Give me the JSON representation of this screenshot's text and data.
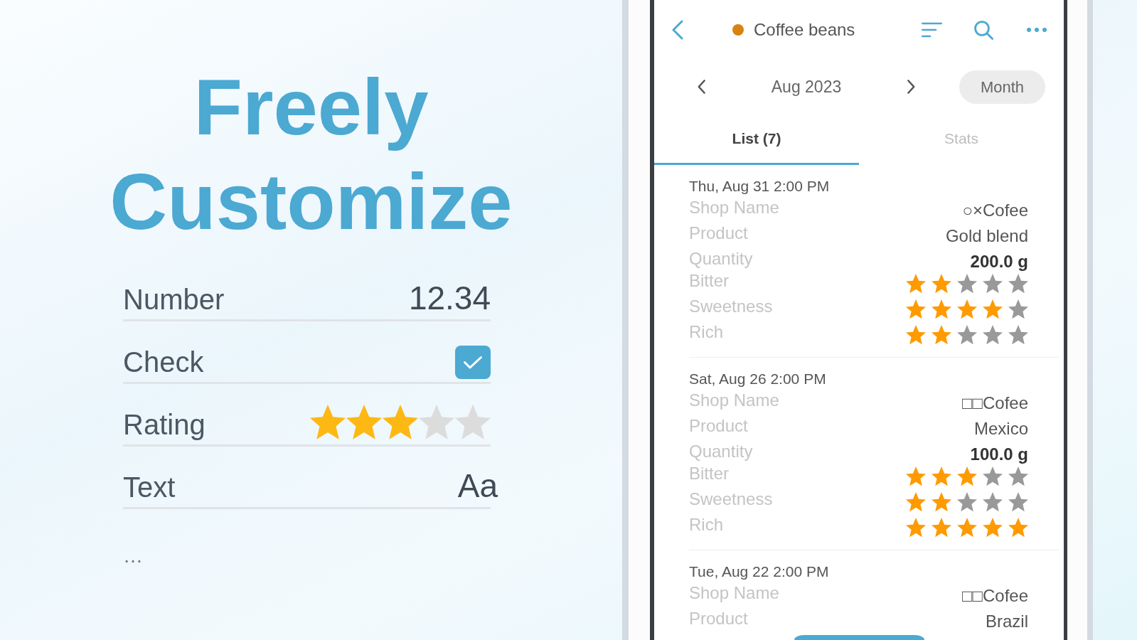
{
  "headline": [
    "Freely",
    "Customize"
  ],
  "field_types": [
    {
      "kind": "number",
      "label": "Number",
      "value": "12.34"
    },
    {
      "kind": "check",
      "label": "Check",
      "checked": true
    },
    {
      "kind": "rating",
      "label": "Rating",
      "stars": 3
    },
    {
      "kind": "text",
      "label": "Text",
      "value": "Aa"
    }
  ],
  "more": "…",
  "phone": {
    "title": "Coffee beans",
    "period": "Aug 2023",
    "period_mode": "Month",
    "tabs": [
      {
        "label": "List (7)",
        "selected": true
      },
      {
        "label": "Stats",
        "selected": false
      }
    ],
    "entries": [
      {
        "date": "Thu, Aug 31 2:00 PM",
        "fields": [
          {
            "kind": "text",
            "label": "Shop Name",
            "value": "○×Cofee"
          },
          {
            "kind": "text",
            "label": "Product",
            "value": "Gold blend"
          },
          {
            "kind": "number",
            "label": "Quantity",
            "value": "200.0 g"
          },
          {
            "kind": "rating",
            "label": "Bitter",
            "stars": 2
          },
          {
            "kind": "rating",
            "label": "Sweetness",
            "stars": 4
          },
          {
            "kind": "rating",
            "label": "Rich",
            "stars": 2
          }
        ]
      },
      {
        "date": "Sat, Aug 26 2:00 PM",
        "fields": [
          {
            "kind": "text",
            "label": "Shop Name",
            "value": "□□Cofee"
          },
          {
            "kind": "text",
            "label": "Product",
            "value": "Mexico"
          },
          {
            "kind": "number",
            "label": "Quantity",
            "value": "100.0 g"
          },
          {
            "kind": "rating",
            "label": "Bitter",
            "stars": 3
          },
          {
            "kind": "rating",
            "label": "Sweetness",
            "stars": 2
          },
          {
            "kind": "rating",
            "label": "Rich",
            "stars": 5
          }
        ]
      },
      {
        "date": "Tue, Aug 22 2:00 PM",
        "fields": [
          {
            "kind": "text",
            "label": "Shop Name",
            "value": "□□Cofee"
          },
          {
            "kind": "text",
            "label": "Product",
            "value": "Brazil"
          }
        ]
      }
    ]
  }
}
